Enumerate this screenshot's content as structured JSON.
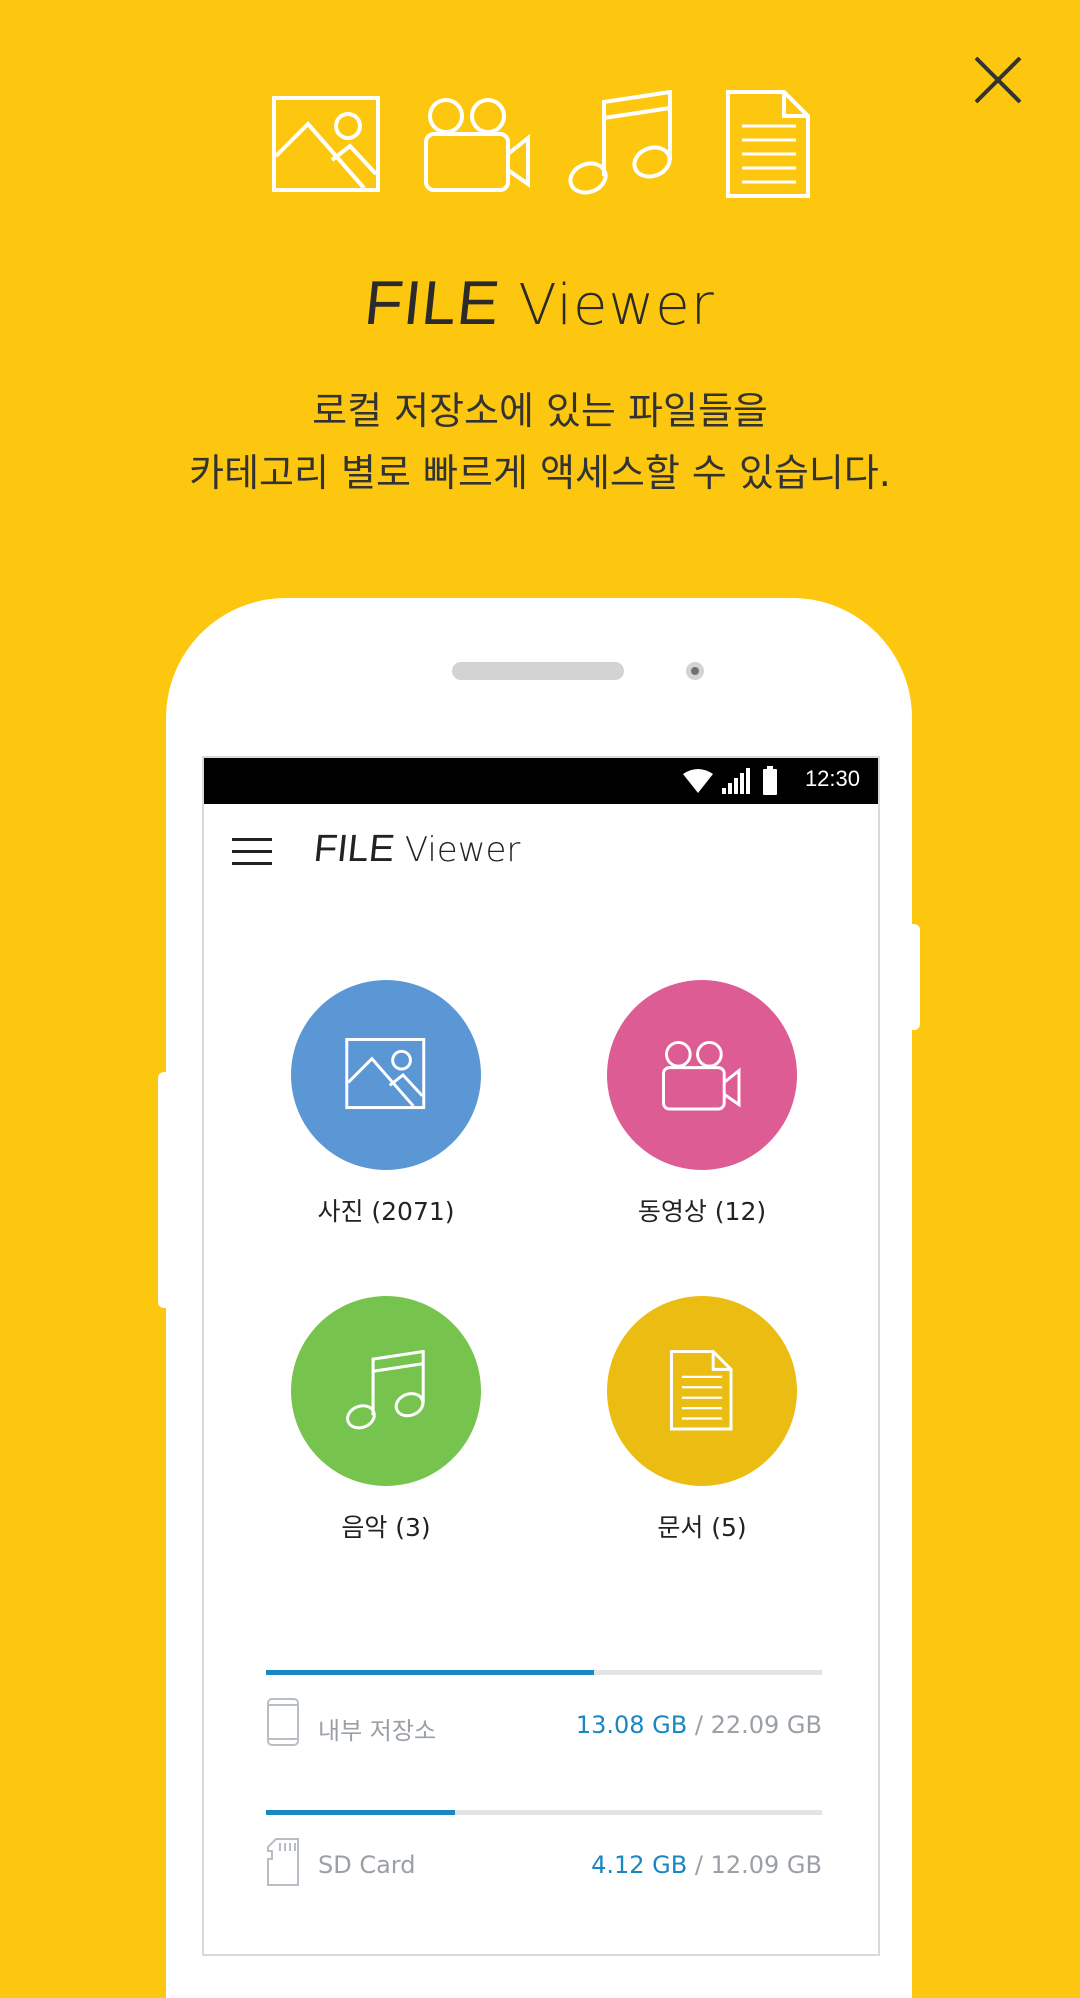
{
  "header": {
    "brand_part1": "FILE",
    "brand_part2": "Viewer",
    "description_line1": "로컬 저장소에 있는 파일들을",
    "description_line2": "카테고리 별로 빠르게 액세스할 수 있습니다."
  },
  "top_icons": [
    "image-icon",
    "video-camera-icon",
    "music-note-icon",
    "document-icon"
  ],
  "phone": {
    "status_time": "12:30",
    "app_title_part1": "FILE",
    "app_title_part2": "Viewer",
    "categories": [
      {
        "label": "사진 (2071)",
        "icon": "image-icon",
        "color": "#5B97D5"
      },
      {
        "label": "동영상 (12)",
        "icon": "video-camera-icon",
        "color": "#DE5C94"
      },
      {
        "label": "음악 (3)",
        "icon": "music-note-icon",
        "color": "#76C44E"
      },
      {
        "label": "문서 (5)",
        "icon": "document-icon",
        "color": "#EBBC12"
      }
    ],
    "storage": [
      {
        "name": "내부 저장소",
        "used": "13.08 GB",
        "total": " / 22.09 GB",
        "fraction": 0.59,
        "icon": "phone-icon"
      },
      {
        "name": "SD Card",
        "used": "4.12 GB",
        "total": " / 12.09 GB",
        "fraction": 0.34,
        "icon": "sd-card-icon"
      }
    ]
  },
  "colors": {
    "background": "#FDC70F",
    "accent_blue": "#1A87C0"
  }
}
